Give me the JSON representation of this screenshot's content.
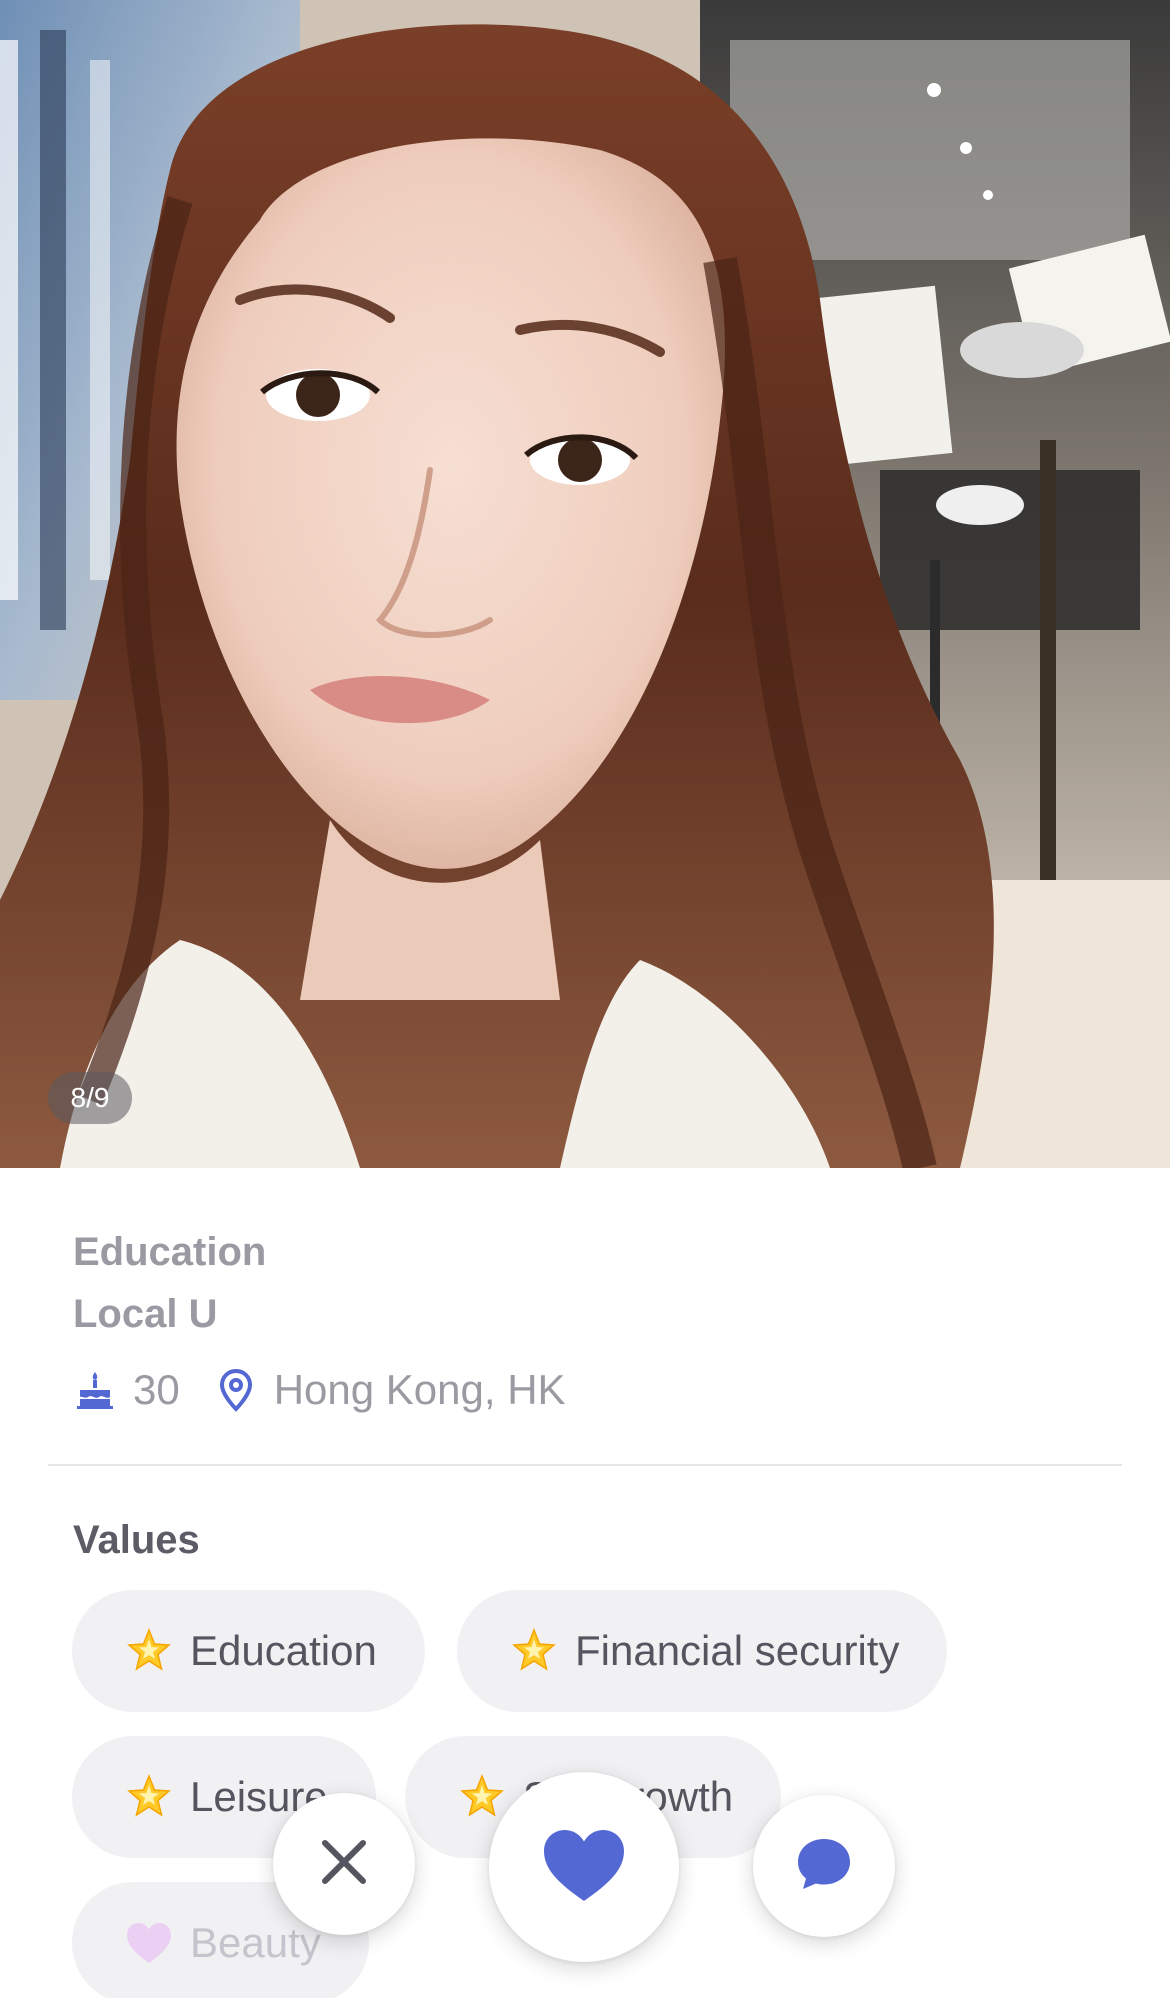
{
  "photo": {
    "counter": "8/9"
  },
  "profile": {
    "education_label": "Education",
    "education_value": "Local U",
    "age": "30",
    "location": "Hong Kong, HK",
    "icons": {
      "age": "birthday-cake-icon",
      "location": "location-pin-icon"
    }
  },
  "values": {
    "title": "Values",
    "chips": [
      {
        "icon": "star-icon",
        "label": "Education"
      },
      {
        "icon": "star-icon",
        "label": "Financial security"
      },
      {
        "icon": "star-icon",
        "label": "Leisure"
      },
      {
        "icon": "star-icon",
        "label": "Self growth"
      },
      {
        "icon": "heart-icon",
        "label": "Beauty"
      }
    ]
  },
  "actions": {
    "pass_icon": "close-icon",
    "like_icon": "heart-icon",
    "chat_icon": "chat-bubble-icon"
  },
  "colors": {
    "accent": "#5468d4",
    "muted_text": "#9a9aa3",
    "chip_bg": "#f1f1f3",
    "beauty_heart": "#e9b6f3"
  }
}
